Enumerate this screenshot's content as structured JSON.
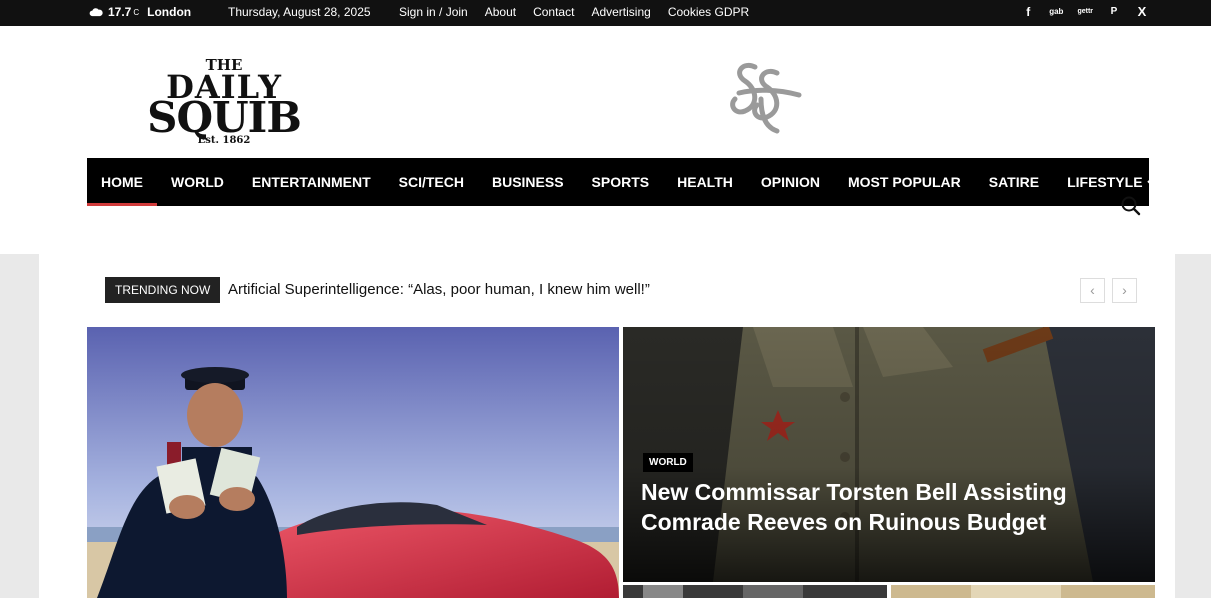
{
  "topbar": {
    "temperature": "17.7",
    "unit": "C",
    "city": "London",
    "date": "Thursday, August 28, 2025",
    "links": [
      "Sign in / Join",
      "About",
      "Contact",
      "Advertising",
      "Cookies GDPR"
    ],
    "social": [
      "f",
      "gab",
      "gettr",
      "P",
      "X"
    ]
  },
  "logo": {
    "the": "THE",
    "daily": "DAILY",
    "squib": "SQUIB",
    "est": "Est. 1862"
  },
  "nav": [
    "HOME",
    "WORLD",
    "ENTERTAINMENT",
    "SCI/TECH",
    "BUSINESS",
    "SPORTS",
    "HEALTH",
    "OPINION",
    "MOST POPULAR",
    "SATIRE",
    "LIFESTYLE"
  ],
  "trending": {
    "label": "TRENDING NOW",
    "text": "Artificial Superintelligence: “Alas, poor human, I knew him well!”",
    "prev": "‹",
    "next": "›"
  },
  "featured": {
    "category": "WORLD",
    "headline": "New Commissar Torsten Bell Assisting Comrade Reeves on Ruinous Budget"
  },
  "colors": {
    "accent": "#d13b3b",
    "topbar": "#111111",
    "nav": "#000000"
  }
}
